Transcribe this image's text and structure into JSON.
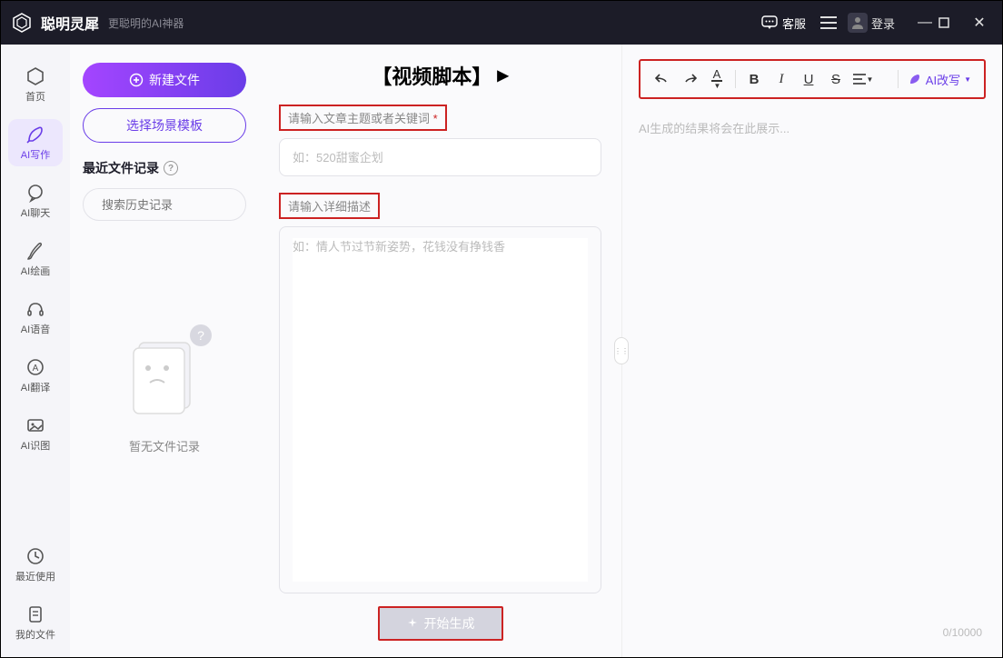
{
  "titlebar": {
    "app_name": "聪明灵犀",
    "subtitle": "更聪明的AI神器",
    "customer_service": "客服",
    "login": "登录"
  },
  "nav": {
    "items": [
      {
        "label": "首页"
      },
      {
        "label": "AI写作"
      },
      {
        "label": "AI聊天"
      },
      {
        "label": "AI绘画"
      },
      {
        "label": "AI语音"
      },
      {
        "label": "AI翻译"
      },
      {
        "label": "AI识图"
      }
    ],
    "bottom": [
      {
        "label": "最近使用"
      },
      {
        "label": "我的文件"
      }
    ]
  },
  "col2": {
    "new_file": "新建文件",
    "select_template": "选择场景模板",
    "history_header": "最近文件记录",
    "search_placeholder": "搜索历史记录",
    "empty_text": "暂无文件记录"
  },
  "mid": {
    "title": "【视频脚本】",
    "label1": "请输入文章主题或者关键词",
    "input1_placeholder": "如：520甜蜜企划",
    "label2": "请输入详细描述",
    "input2_placeholder": "如：情人节过节新姿势，花钱没有挣钱香",
    "gen_btn": "开始生成"
  },
  "right": {
    "toolbar": {
      "undo": "↶",
      "redo": "↷",
      "text_color": "A",
      "bold": "B",
      "italic": "I",
      "underline": "U",
      "strike": "S",
      "align": "≡",
      "ai_rewrite": "AI改写"
    },
    "placeholder": "AI生成的结果将会在此展示...",
    "char_count": "0/10000"
  }
}
